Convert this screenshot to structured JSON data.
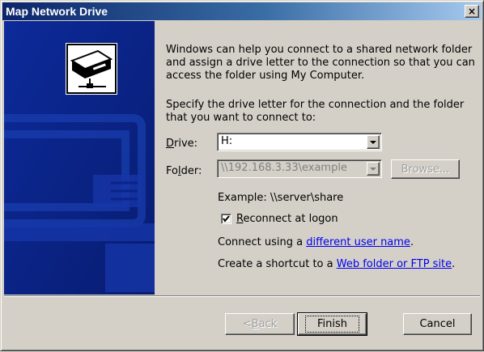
{
  "window": {
    "title": "Map Network Drive",
    "close_symbol": "×"
  },
  "intro": {
    "line1": "Windows can help you connect to a shared network folder",
    "line2": "and assign a drive letter to the connection so that you can",
    "line3": "access the folder using My Computer.",
    "line4": "Specify the drive letter for the connection and the folder",
    "line5": "that you want to connect to:"
  },
  "drive": {
    "label_accel": "D",
    "label_rest": "rive:",
    "value": "H:"
  },
  "folder": {
    "label_pre": "Fo",
    "label_accel": "l",
    "label_post": "der:",
    "value": "\\\\192.168.3.33\\example",
    "browse_label": "Browse..."
  },
  "example_text": "Example: \\\\server\\share",
  "reconnect": {
    "label_accel": "R",
    "label_rest": "econnect at logon",
    "checked": true
  },
  "connect_using": {
    "prefix": "Connect using a ",
    "link": "different user name",
    "suffix": "."
  },
  "shortcut": {
    "prefix": "Create a shortcut to a ",
    "link": "Web folder or FTP site",
    "suffix": "."
  },
  "buttons": {
    "back_pre": "< ",
    "back_accel": "B",
    "back_post": "ack",
    "finish": "Finish",
    "cancel": "Cancel"
  },
  "icons": {
    "close": "close-icon",
    "network_drive": "network-drive-icon",
    "dropdown": "chevron-down-icon",
    "check": "check-icon"
  },
  "colors": {
    "title_gradient_start": "#0a246a",
    "title_gradient_end": "#a6caf0",
    "side_panel": "#0a2488",
    "face": "#d4d0c8",
    "link": "#0000ee"
  }
}
